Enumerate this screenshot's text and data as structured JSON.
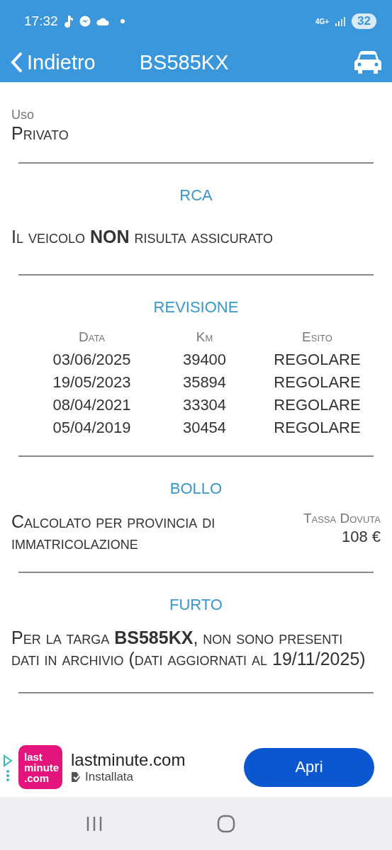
{
  "status_bar": {
    "time": "17:32",
    "network": "4G+",
    "battery": "32"
  },
  "header": {
    "back_label": "Indietro",
    "title": "BS585KX"
  },
  "uso": {
    "label": "Uso",
    "value": "Privato"
  },
  "rca": {
    "title": "RCA",
    "text": "Il veicolo **NON** risulta assicurato"
  },
  "revisione": {
    "title": "REVISIONE",
    "columns": [
      "Data",
      "Km",
      "Esito"
    ],
    "rows": [
      [
        "03/06/2025",
        "39400",
        "REGOLARE"
      ],
      [
        "19/05/2023",
        "35894",
        "REGOLARE"
      ],
      [
        "08/04/2021",
        "33304",
        "REGOLARE"
      ],
      [
        "05/04/2019",
        "30454",
        "REGOLARE"
      ]
    ]
  },
  "bollo": {
    "title": "BOLLO",
    "text": "Calcolato per provincia di immatricolazione",
    "tax_label": "Tassa Dovuta",
    "tax_value": "108 €"
  },
  "furto": {
    "title": "FURTO",
    "text": "Per la targa **BS585KX**, non sono presenti dati in archivio (dati aggiornati al 19/11/2025)"
  },
  "ad": {
    "logo_lines": [
      "last",
      "minute",
      ".com"
    ],
    "app_name": "lastminute.com",
    "status": "Installata",
    "button": "Apri"
  }
}
